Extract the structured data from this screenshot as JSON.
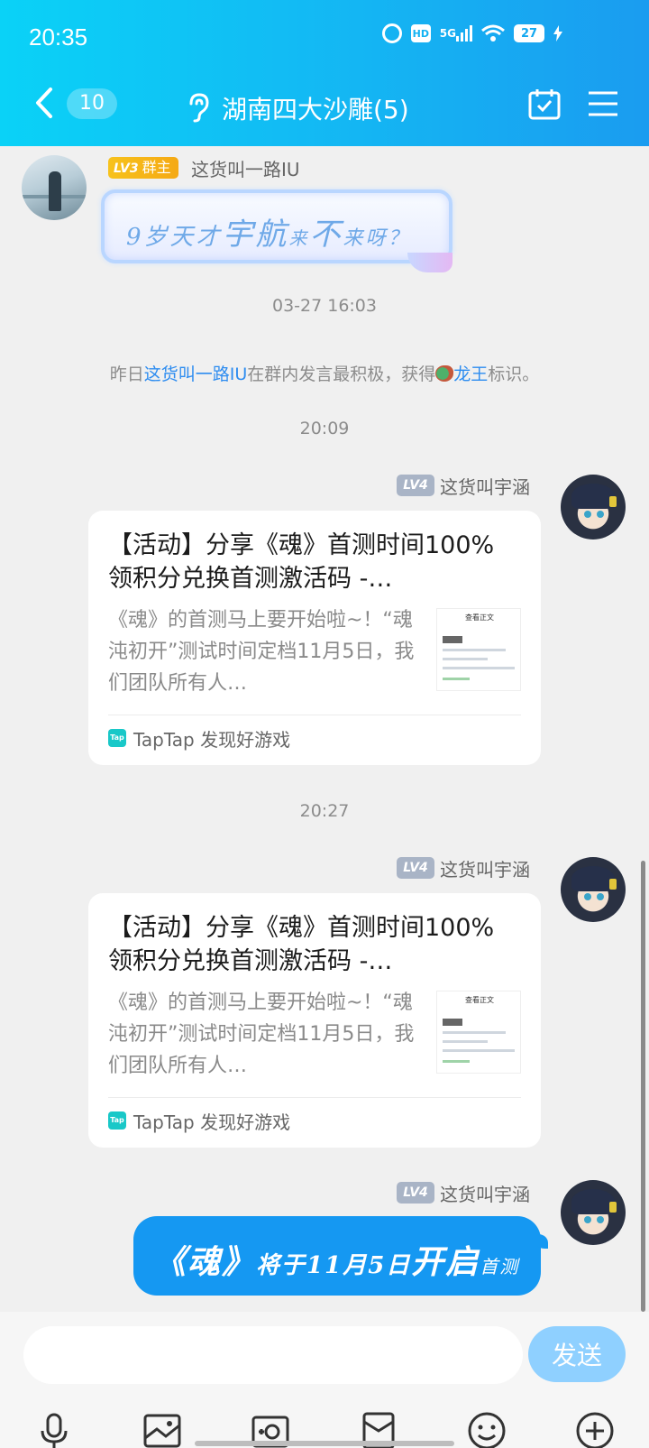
{
  "status_bar": {
    "time": "20:35",
    "hd_label": "HD",
    "network_label": "5G",
    "battery_level": "27"
  },
  "header": {
    "unread_count": "10",
    "chat_title": "湖南四大沙雕(5)"
  },
  "messages": [
    {
      "sender_level": "LV3",
      "sender_role": "群主",
      "sender_name": "这货叫一路IU",
      "sticker_text_parts": [
        "9岁天才",
        "宇航",
        "来",
        "不",
        "来呀？"
      ]
    },
    {
      "sender_level": "LV4",
      "sender_name": "这货叫宇涵",
      "card": {
        "title": "【活动】分享《魂》首测时间100%领积分兑换首测激活码 -…",
        "description": "《魂》的首测马上要开始啦~！“魂沌初开”测试时间定档11月5日，我们团队所有人…",
        "source": "TapTap 发现好游戏",
        "thumb_title": "查看正文"
      }
    },
    {
      "sender_level": "LV4",
      "sender_name": "这货叫宇涵",
      "card": {
        "title": "【活动】分享《魂》首测时间100%领积分兑换首测激活码 -…",
        "description": "《魂》的首测马上要开始啦~！“魂沌初开”测试时间定档11月5日，我们团队所有人…",
        "source": "TapTap 发现好游戏",
        "thumb_title": "查看正文"
      }
    },
    {
      "sender_level": "LV4",
      "sender_name": "这货叫宇涵",
      "bubble_parts": [
        "《魂》",
        "将于11月5日",
        "开启",
        "首测"
      ]
    }
  ],
  "timestamps": [
    "03-27 16:03",
    "20:09",
    "20:27"
  ],
  "system_notice": {
    "prefix": "昨日",
    "user": "这货叫一路IU",
    "middle": "在群内发言最积极，获得",
    "title": "龙王",
    "suffix": "标识。"
  },
  "tap_logo": "Tap",
  "input": {
    "value": "",
    "send_label": "发送"
  },
  "icons": {
    "back": "chevron-left-icon",
    "ear": "ear-icon",
    "calendar": "calendar-check-icon",
    "menu": "menu-icon",
    "toolbar": [
      "microphone-icon",
      "image-icon",
      "camera-icon",
      "red-packet-icon",
      "emoji-icon",
      "plus-icon"
    ]
  },
  "colors": {
    "header_gradient_start": "#0ad2f7",
    "header_gradient_end": "#1a9cf0",
    "bubble": "#1598f2",
    "link": "#2d8cf0",
    "send_button": "#8fd0ff"
  }
}
